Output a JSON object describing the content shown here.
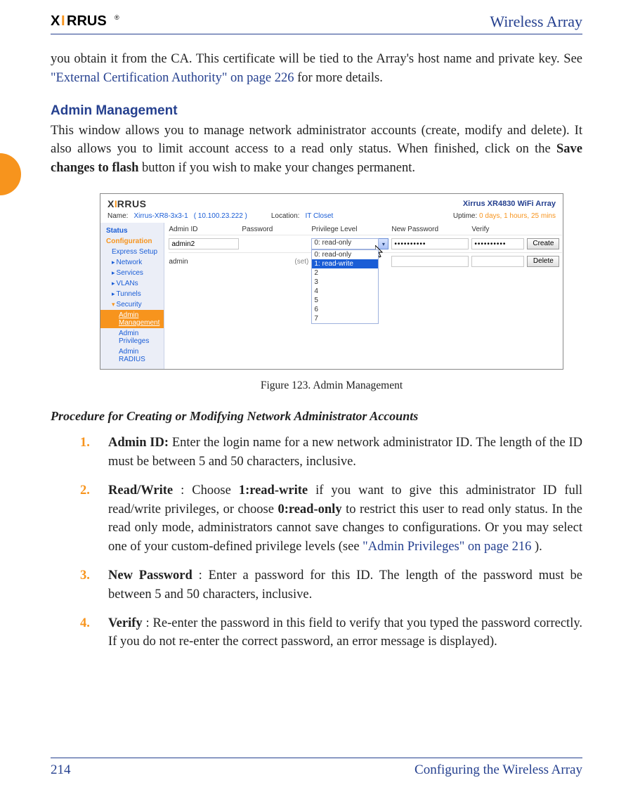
{
  "header": {
    "title": "Wireless Array",
    "logo_text_1": "X",
    "logo_text_2": "I",
    "logo_text_3": "RRUS",
    "logo_reg": "®"
  },
  "intro": {
    "pre": "you obtain it from the CA. This certificate will be tied to the Array's host name and private key. See ",
    "link": "\"External Certification Authority\" on page 226",
    "post": " for more details."
  },
  "section": {
    "title": "Admin Management",
    "body_pre": "This window allows you to manage network administrator accounts (create, modify and delete). It also allows you to limit account access to a read only status. When finished, click on the ",
    "body_bold": "Save changes to flash",
    "body_post": " button if you wish to make your changes permanent."
  },
  "shot": {
    "logo1": "X",
    "logo2": "I",
    "logo3": "RRUS",
    "product": "Xirrus XR4830 WiFi Array",
    "name_lbl": "Name:",
    "name_val": "Xirrus-XR8-3x3-1",
    "name_ip": "( 10.100.23.222 )",
    "loc_lbl": "Location:",
    "loc_val": "IT Closet",
    "up_lbl": "Uptime:",
    "up_val": "0 days, 1 hours, 25 mins",
    "sidebar": {
      "status": "Status",
      "config": "Configuration",
      "express": "Express Setup",
      "network": "Network",
      "services": "Services",
      "vlans": "VLANs",
      "tunnels": "Tunnels",
      "security": "Security",
      "admin_mgmt": "Admin Management",
      "admin_priv": "Admin Privileges",
      "admin_radius": "Admin RADIUS"
    },
    "cols": {
      "c1": "Admin ID",
      "c2": "Password",
      "c3": "Privilege Level",
      "c4": "New Password",
      "c5": "Verify"
    },
    "rows": {
      "r1": {
        "id": "admin2",
        "pw_set": "",
        "sel": "0: read-only",
        "newpw": "••••••••••",
        "verify": "••••••••••",
        "btn": "Create"
      },
      "r2": {
        "id": "admin",
        "pw_set": "(set)",
        "sel": "",
        "newpw": "",
        "verify": "",
        "btn": "Delete"
      }
    },
    "dd": {
      "o0": "0: read-only",
      "o1": "1: read-write",
      "o2": "2",
      "o3": "3",
      "o4": "4",
      "o5": "5",
      "o6": "6",
      "o7": "7"
    }
  },
  "figcap": "Figure 123. Admin Management",
  "proc_title": "Procedure for Creating or Modifying Network Administrator Accounts",
  "steps": [
    {
      "num": "1.",
      "bold": "Admin ID:",
      "rest": " Enter the login name for a new network administrator ID. The length of the ID must be between 5 and 50 characters, inclusive."
    },
    {
      "num": "2.",
      "bold": "Read/Write",
      "mid1": ": Choose ",
      "b2": "1:read-write",
      "mid2": " if you want to give this administrator ID full read/write privileges, or choose ",
      "b3": "0:read-only",
      "mid3": " to restrict this user to read only status. In the read only mode, administrators cannot save changes to configurations. Or you may select one of your custom-defined privilege levels (see ",
      "link": "\"Admin Privileges\" on page 216",
      "mid4": ")."
    },
    {
      "num": "3.",
      "bold": "New Password",
      "rest": ": Enter a password for this ID. The length of the password must be between 5 and 50 characters, inclusive."
    },
    {
      "num": "4.",
      "bold": "Verify",
      "rest": ": Re-enter the password in this field to verify that you typed the password correctly. If you do not re-enter the correct password, an error message is displayed)."
    }
  ],
  "footer": {
    "page": "214",
    "section": "Configuring the Wireless Array"
  }
}
